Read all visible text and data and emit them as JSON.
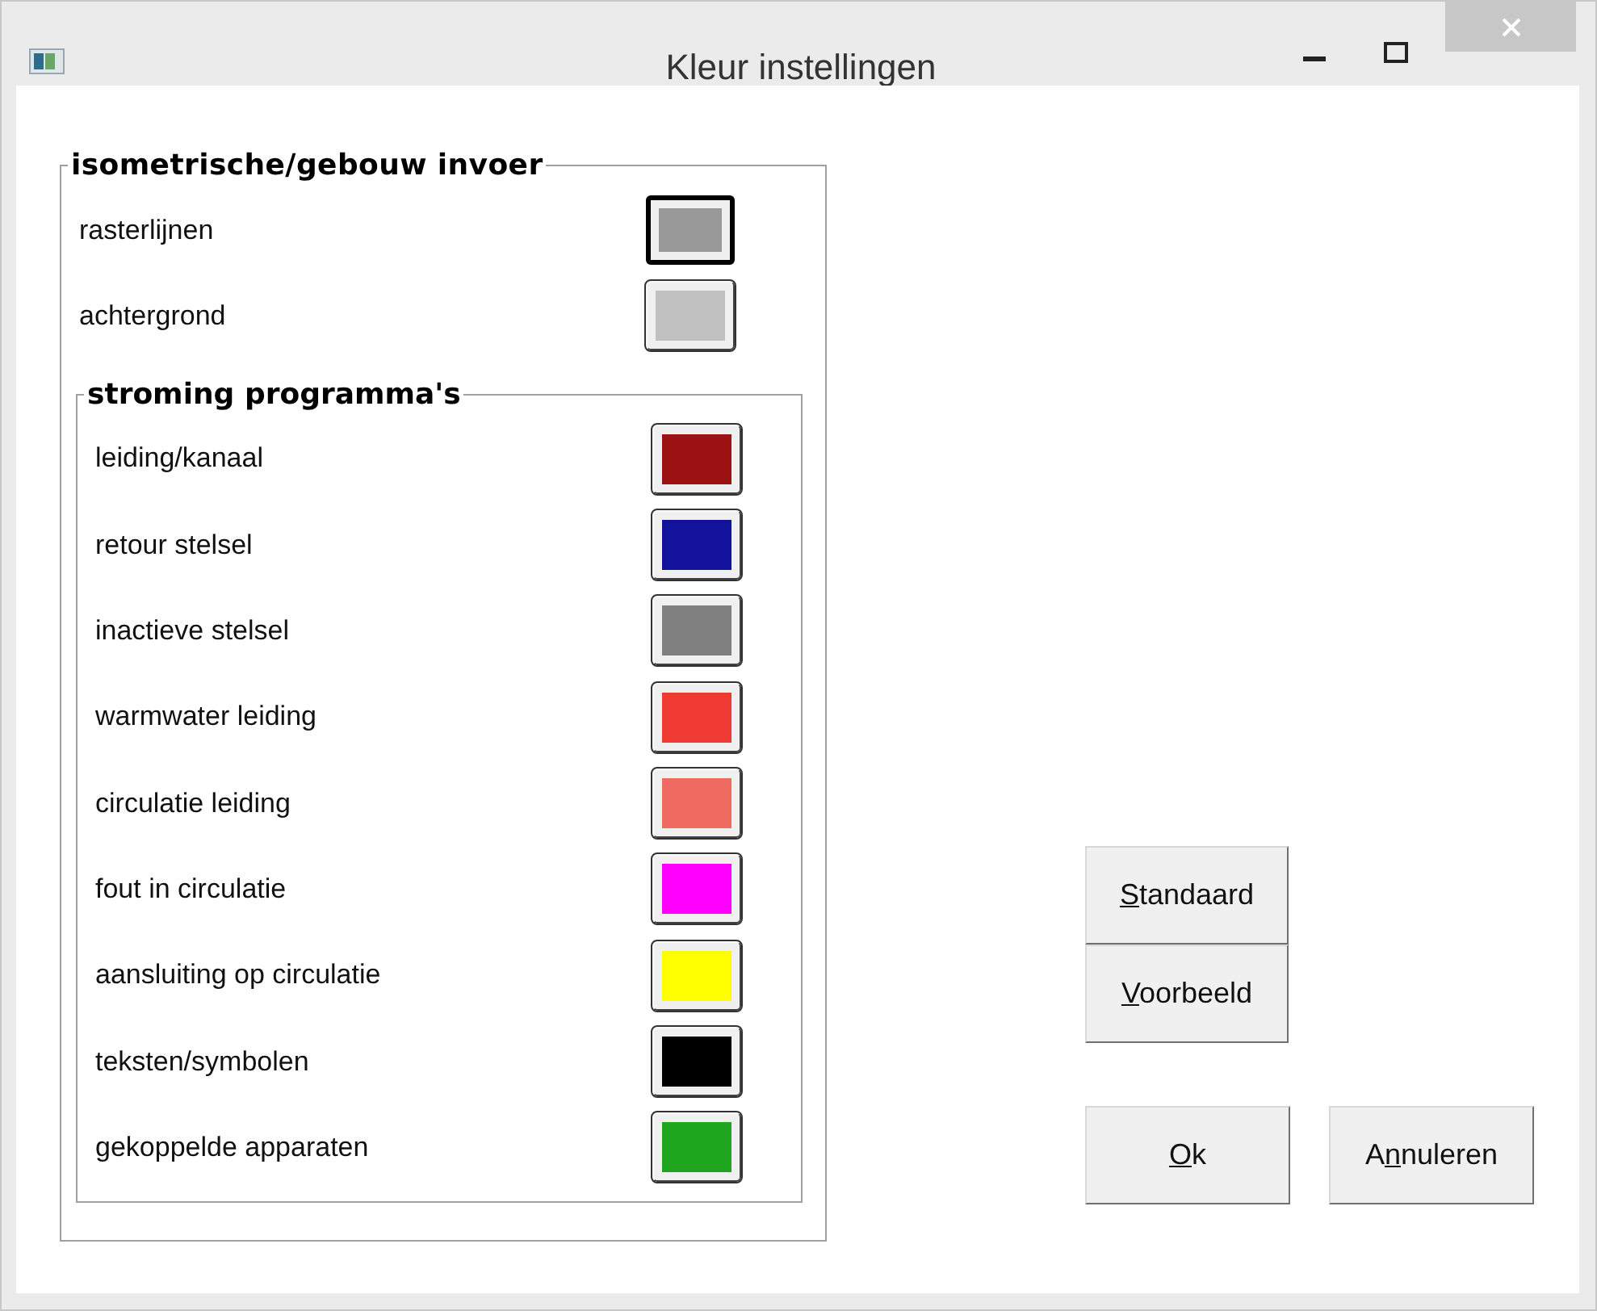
{
  "window": {
    "title": "Kleur instellingen"
  },
  "group": {
    "title": "isometrische/gebouw invoer",
    "items": [
      {
        "label": "rasterlijnen",
        "color": "#999999",
        "focused": true
      },
      {
        "label": "achtergrond",
        "color": "#c0c0c0",
        "focused": false
      }
    ],
    "subgroup": {
      "title": "stroming programma's",
      "items": [
        {
          "label": "leiding/kanaal",
          "color": "#9c1212",
          "focused": false
        },
        {
          "label": "retour stelsel",
          "color": "#12129c",
          "focused": false
        },
        {
          "label": "inactieve stelsel",
          "color": "#808080",
          "focused": false
        },
        {
          "label": "warmwater leiding",
          "color": "#ee3a33",
          "focused": false
        },
        {
          "label": "circulatie leiding",
          "color": "#ef6a60",
          "focused": false
        },
        {
          "label": "fout in circulatie",
          "color": "#ff00ff",
          "focused": false
        },
        {
          "label": "aansluiting op circulatie",
          "color": "#ffff00",
          "focused": false
        },
        {
          "label": "teksten/symbolen",
          "color": "#000000",
          "focused": false
        },
        {
          "label": "gekoppelde apparaten",
          "color": "#1ea61e",
          "focused": false
        }
      ]
    }
  },
  "buttons": [
    {
      "access_key": "S",
      "label_rest": "tandaard"
    },
    {
      "access_key": "V",
      "label_rest": "oorbeeld"
    }
  ],
  "dialog_buttons": [
    {
      "access_key": "O",
      "label_rest": "k"
    },
    {
      "label_start": "A",
      "access_key": "n",
      "label_rest": "nuleren"
    }
  ]
}
